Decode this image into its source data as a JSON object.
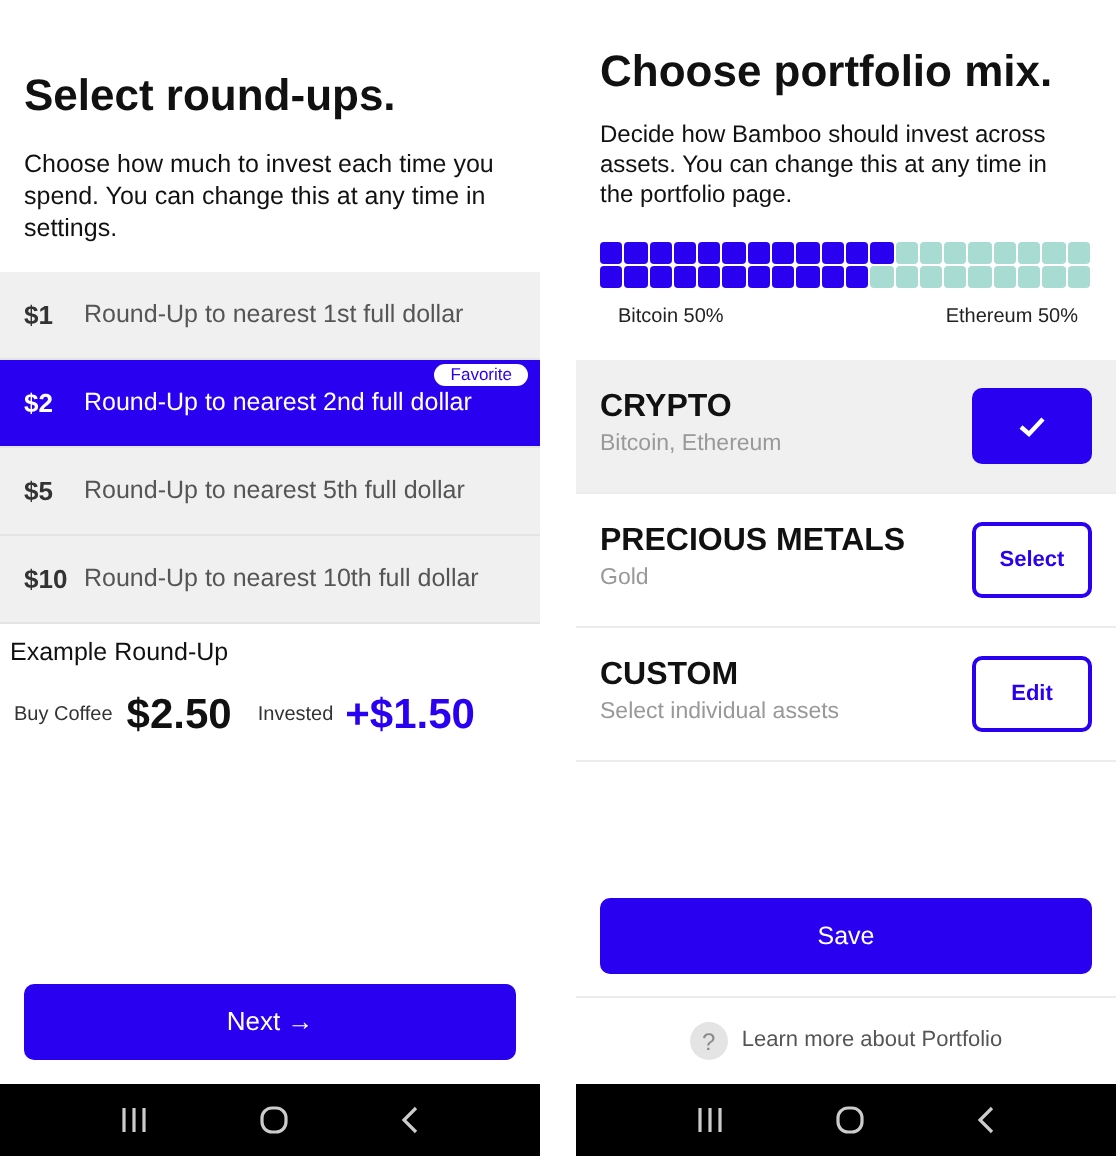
{
  "roundups_screen": {
    "title": "Select round-ups.",
    "description": "Choose how much to invest each time you spend. You can change this at any time in settings.",
    "options": [
      {
        "amount": "$1",
        "label": "Round-Up to nearest 1st full dollar",
        "selected": false
      },
      {
        "amount": "$2",
        "label": "Round-Up to nearest 2nd full dollar",
        "selected": true,
        "badge": "Favorite"
      },
      {
        "amount": "$5",
        "label": "Round-Up to nearest 5th full dollar",
        "selected": false
      },
      {
        "amount": "$10",
        "label": "Round-Up to nearest 10th full dollar",
        "selected": false
      }
    ],
    "example": {
      "heading": "Example Round-Up",
      "purchase_label": "Buy Coffee",
      "purchase_amount": "$2.50",
      "invested_label": "Invested",
      "invested_amount": "+$1.50"
    },
    "next_button": "Next →"
  },
  "portfolio_screen": {
    "title": "Choose portfolio mix.",
    "description": "Decide how Bamboo should invest across assets. You can change this at any time in the portfolio page.",
    "mix": {
      "left_label": "Bitcoin 50%",
      "right_label": "Ethereum 50%"
    },
    "portfolios": [
      {
        "name": "CRYPTO",
        "assets": "Bitcoin, Ethereum",
        "selected": true,
        "kind": "check"
      },
      {
        "name": "PRECIOUS METALS",
        "assets": "Gold",
        "selected": false,
        "kind": "select",
        "action": "Select"
      },
      {
        "name": "CUSTOM",
        "assets": "Select individual assets",
        "selected": false,
        "kind": "edit",
        "action": "Edit"
      }
    ],
    "save_button": "Save",
    "help_icon_text": "?",
    "help_link": "Learn more about Portfolio"
  }
}
